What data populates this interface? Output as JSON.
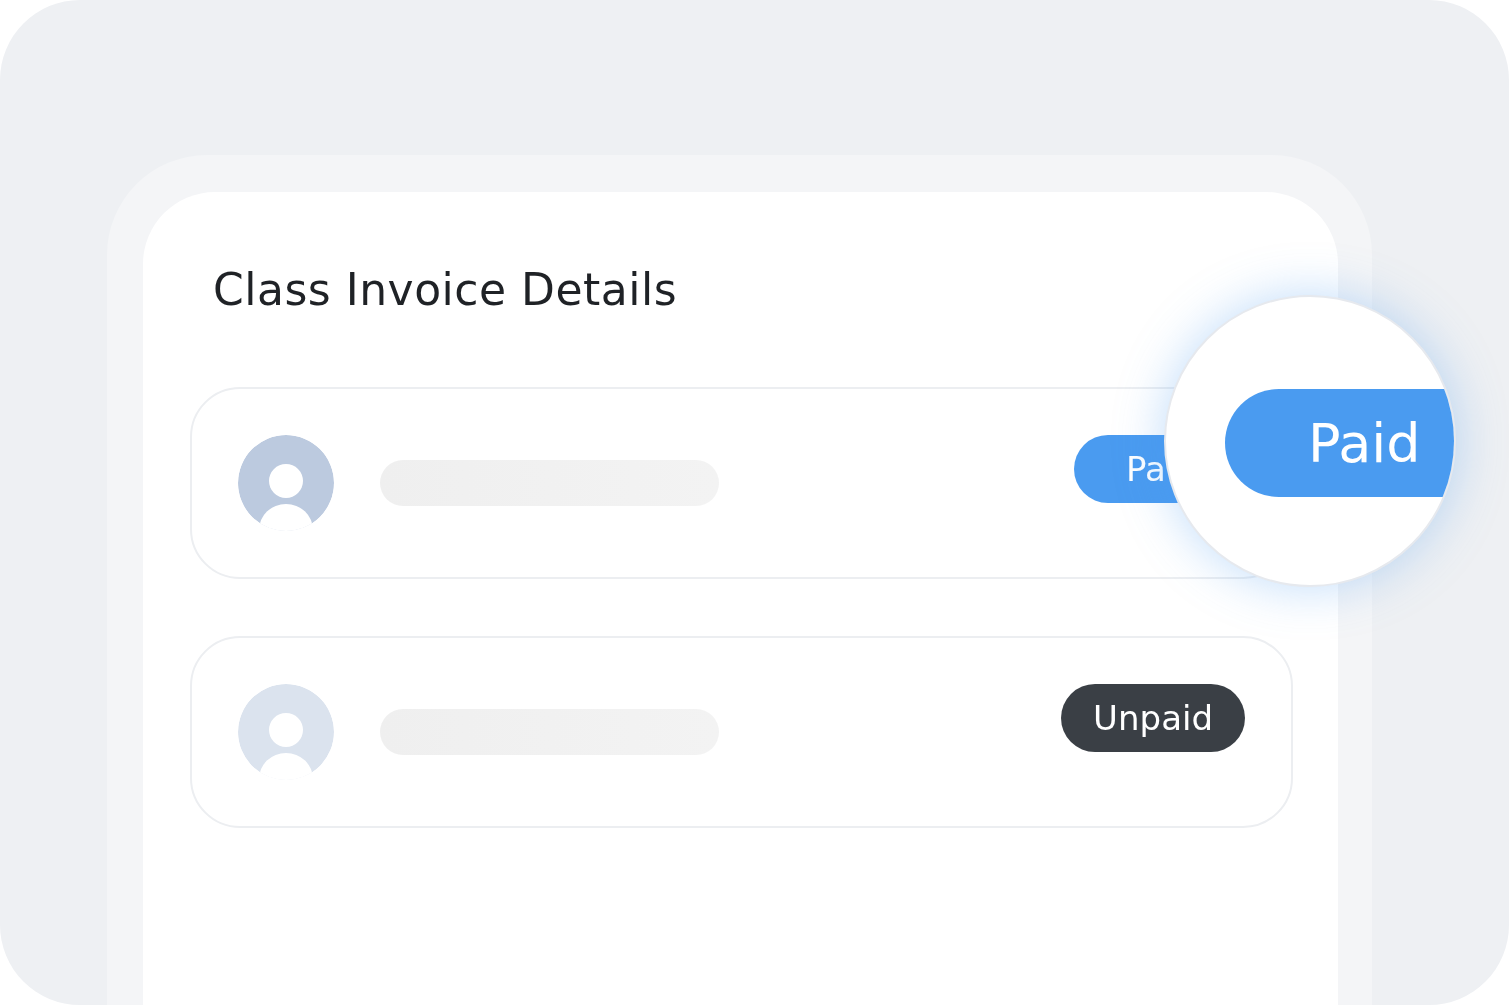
{
  "title": "Class Invoice Details",
  "rows": [
    {
      "color": "#bccadf",
      "status": {
        "kind": "paid",
        "label": "Pa"
      }
    },
    {
      "color": "#dbe3ee",
      "status": {
        "kind": "unpaid",
        "label": "Unpaid"
      }
    }
  ],
  "magnifier": {
    "kind": "paid",
    "label": "Paid"
  }
}
